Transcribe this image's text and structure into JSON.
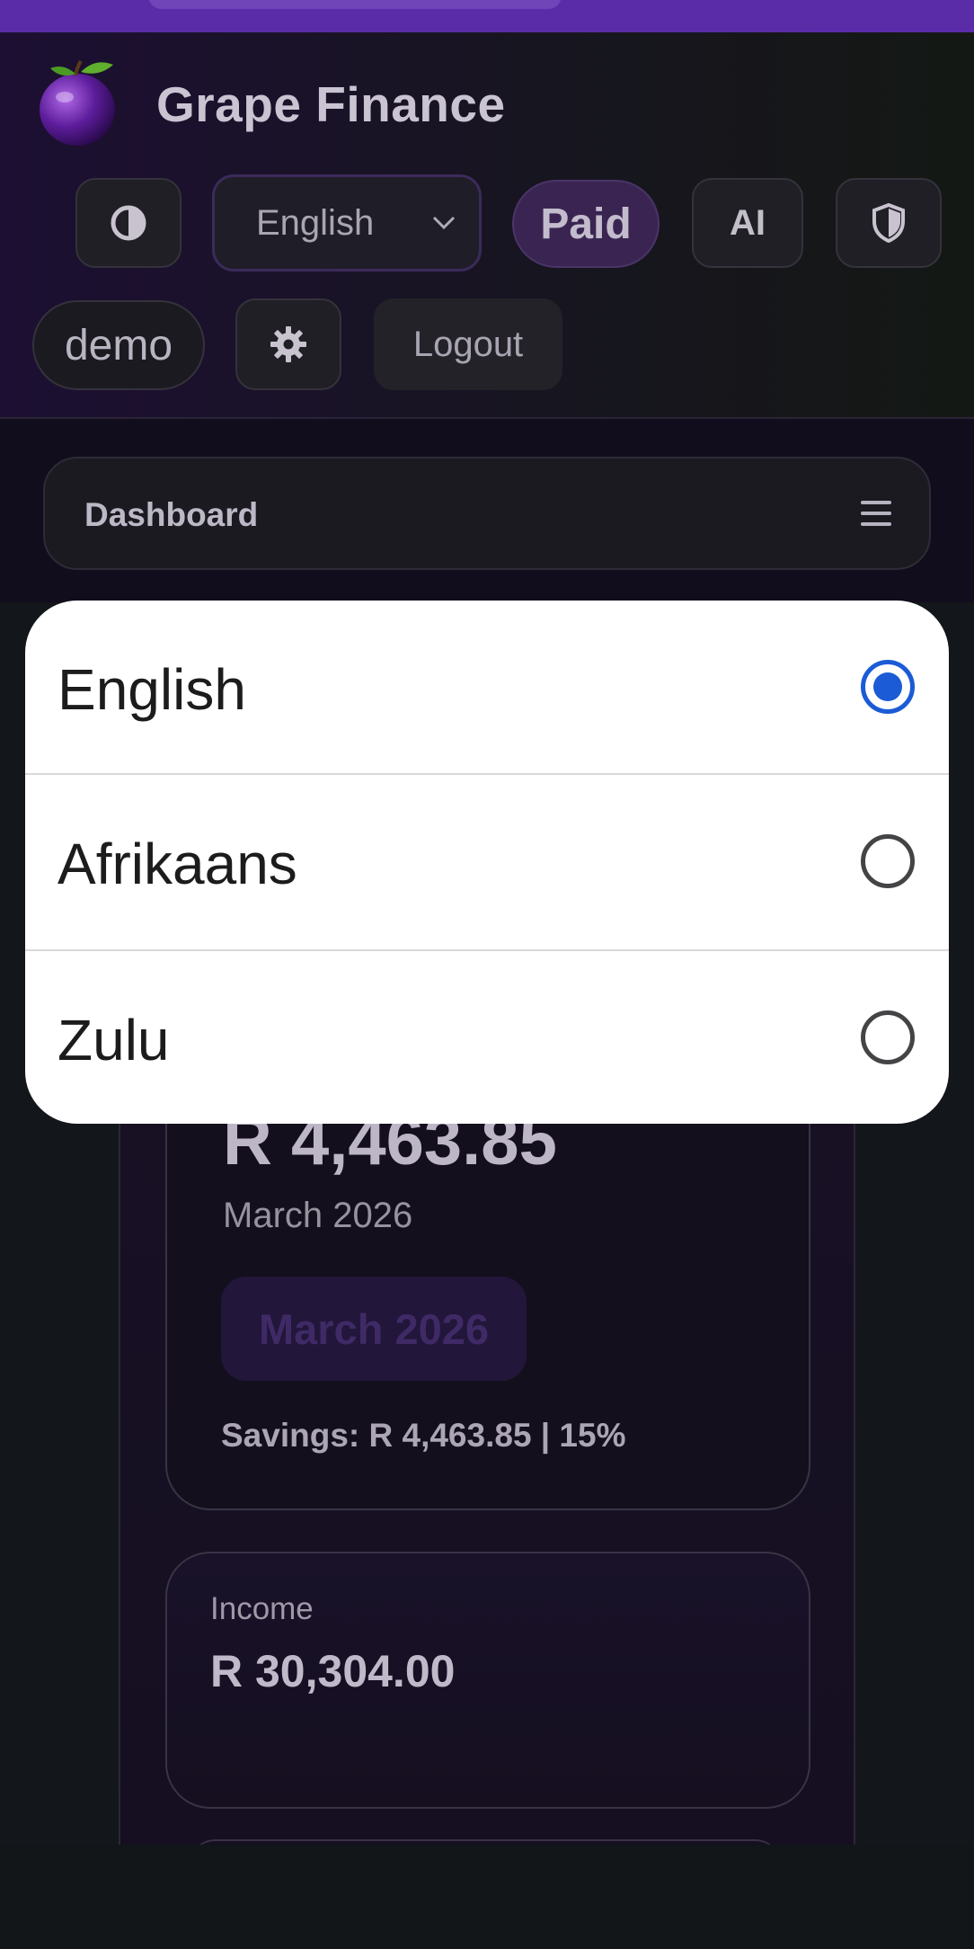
{
  "app": {
    "title": "Grape Finance"
  },
  "header": {
    "language_value": "English",
    "plan_badge": "Paid",
    "ai_label": "AI",
    "user_label": "demo",
    "logout_label": "Logout"
  },
  "nav": {
    "label": "Dashboard"
  },
  "summary": {
    "amount": "R 4,463.85",
    "month": "March 2026",
    "month_chip": "March 2026",
    "savings": "Savings: R 4,463.85 | 15%"
  },
  "income": {
    "label": "Income",
    "value": "R 30,304.00"
  },
  "language_dialog": {
    "options": [
      {
        "label": "English",
        "selected": true
      },
      {
        "label": "Afrikaans",
        "selected": false
      },
      {
        "label": "Zulu",
        "selected": false
      }
    ]
  },
  "colors": {
    "accent": "#5b2ca8",
    "radio_selected": "#1b5bd6"
  }
}
